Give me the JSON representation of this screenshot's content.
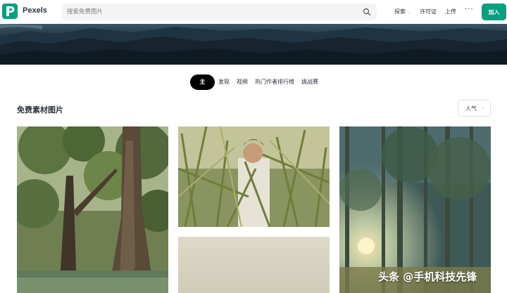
{
  "header": {
    "brand": "Pexels",
    "search_placeholder": "搜索免费图片",
    "nav": {
      "explore": "探索",
      "license": "许可证",
      "upload": "上传",
      "more": "···"
    },
    "join": "加入"
  },
  "tabs": [
    {
      "label": "主页",
      "active": true
    },
    {
      "label": "发现",
      "active": false
    },
    {
      "label": "视频",
      "active": false
    },
    {
      "label": "热门作者排行榜",
      "active": false
    },
    {
      "label": "挑战赛",
      "active": false
    }
  ],
  "section": {
    "title": "免费素材图片",
    "sort": "人气"
  },
  "watermark": "头条 @手机科技先锋",
  "colors": {
    "brand": "#05a081",
    "active_tab": "#000000"
  },
  "icons": {
    "logo": "pexels-logo-icon",
    "search": "search-icon",
    "chevron": "chevron-down-icon"
  }
}
